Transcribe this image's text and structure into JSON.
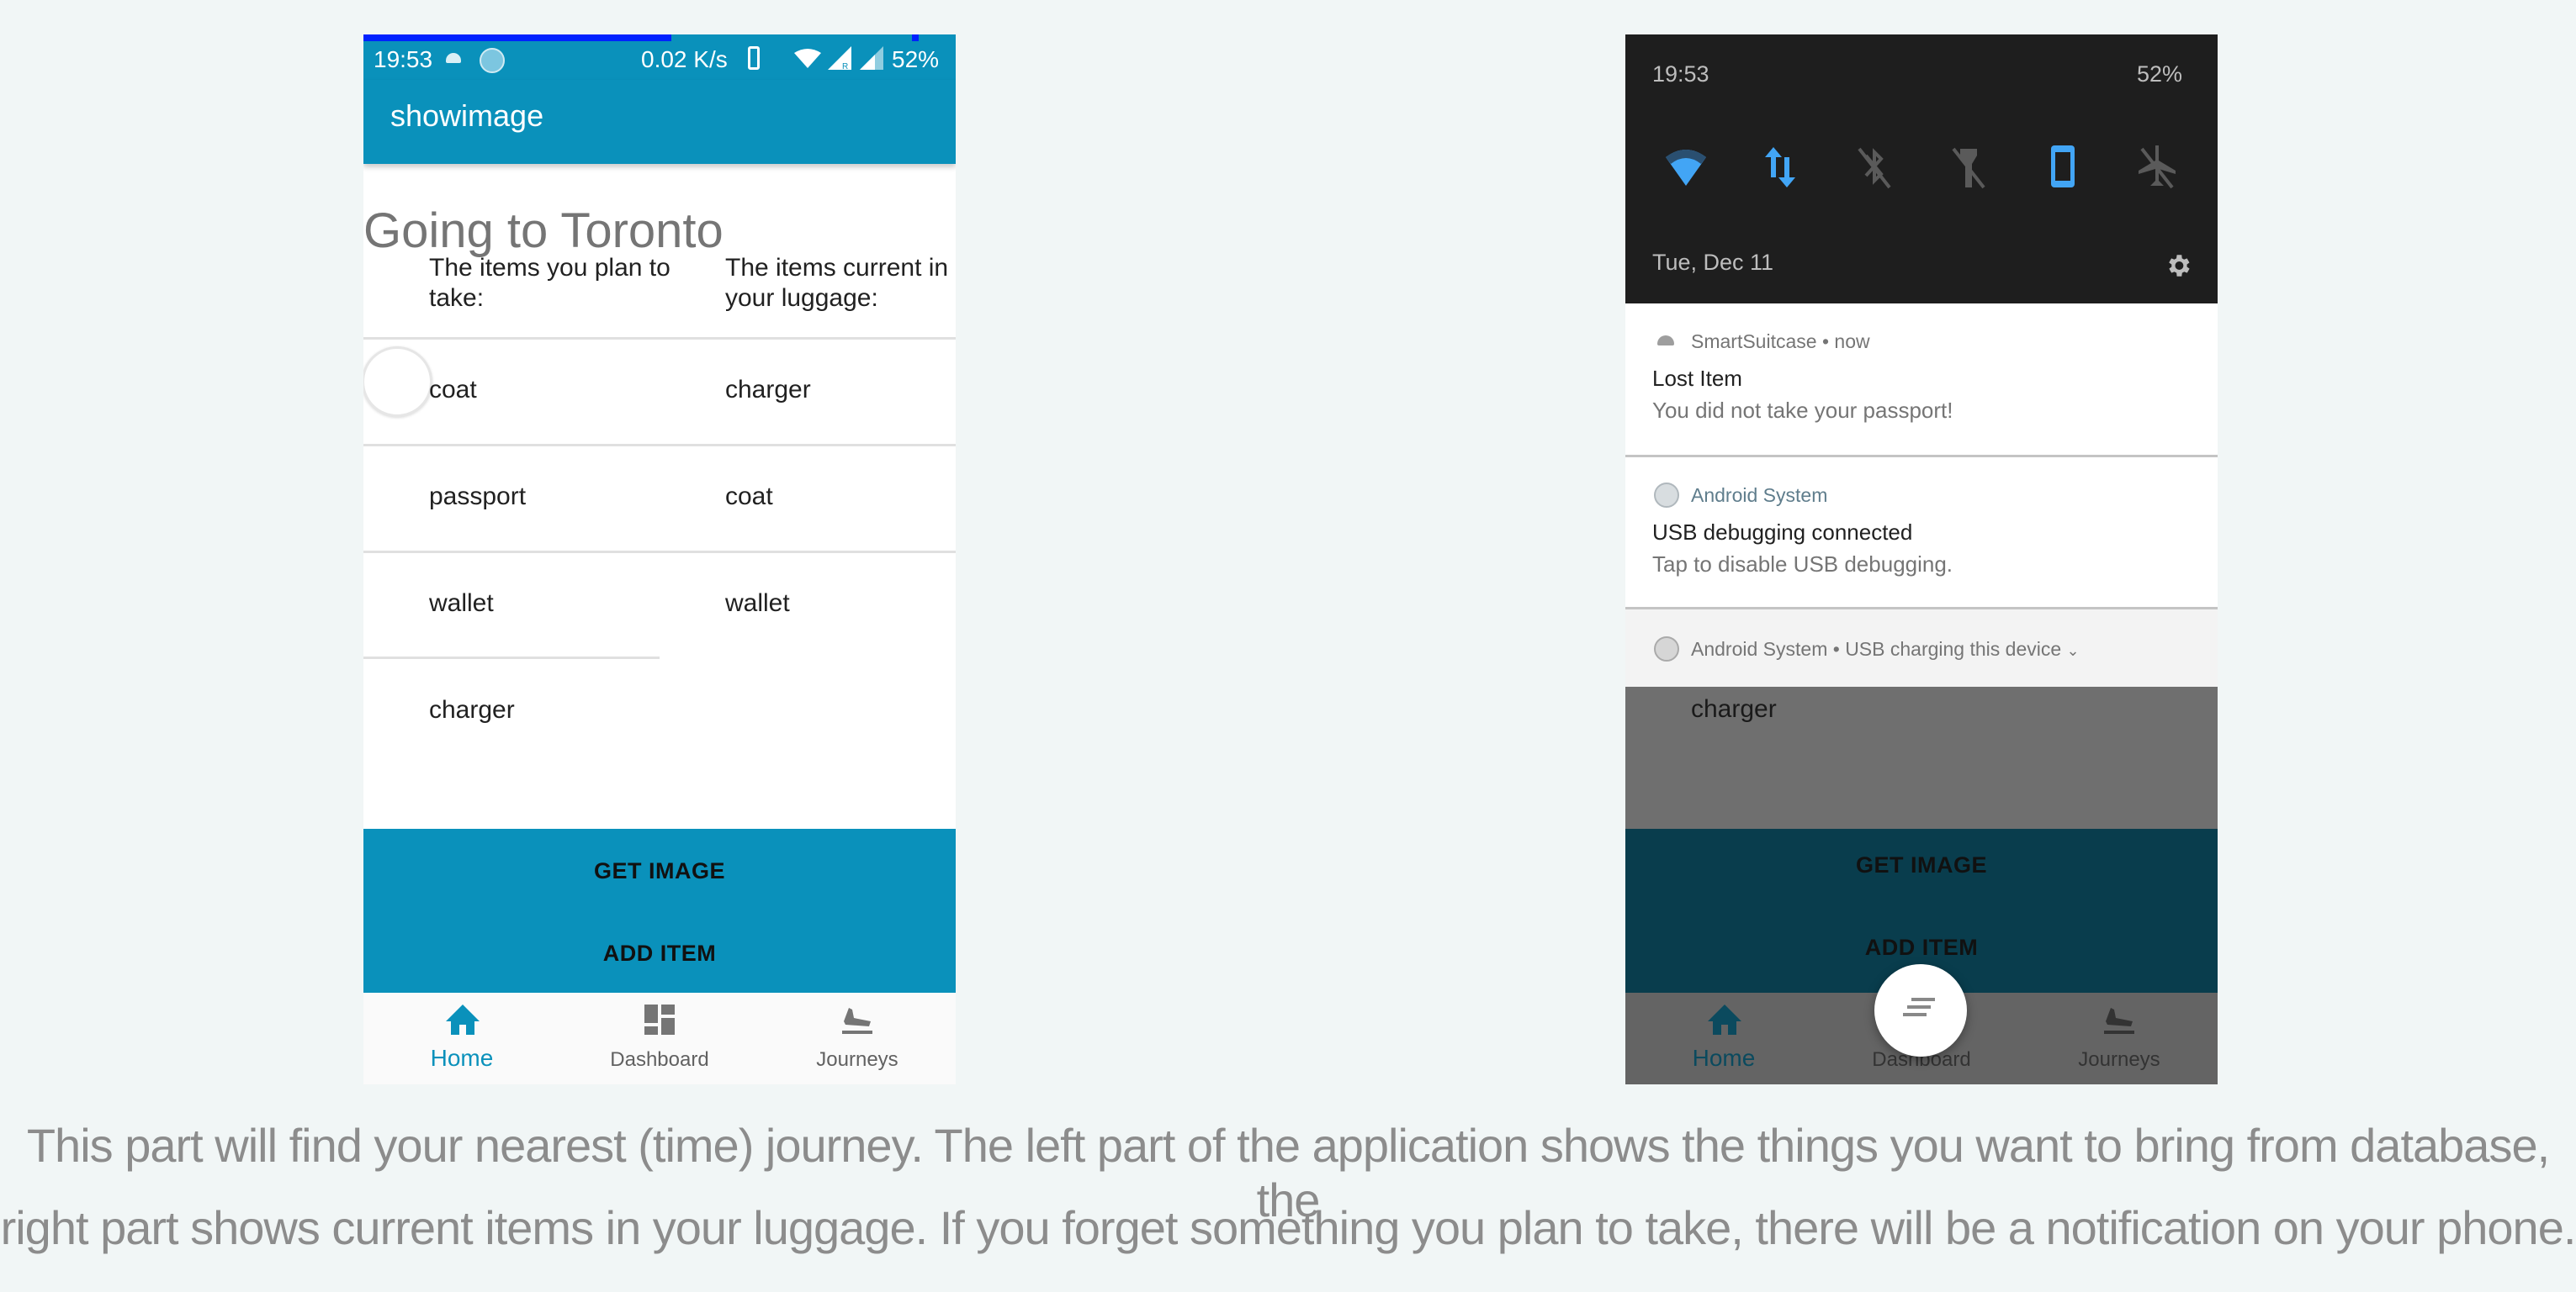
{
  "left_phone": {
    "status_bar": {
      "time": "19:53",
      "net_speed": "0.02 K/s",
      "battery": "52%",
      "download_progress_percent": 52,
      "icons": [
        "android-icon",
        "sync-icon",
        "vibrate-icon",
        "wifi-icon",
        "signal-roaming-icon",
        "signal-icon"
      ]
    },
    "app_bar": {
      "title": "showimage"
    },
    "page_title": "Going to Toronto",
    "columns": {
      "planned_header": "The items you plan to take:",
      "current_header": "The items current in your luggage:"
    },
    "planned_items": [
      "coat",
      "passport",
      "wallet",
      "charger"
    ],
    "current_items": [
      "charger",
      "coat",
      "wallet"
    ],
    "buttons": {
      "get_image": "GET IMAGE",
      "add_item": "ADD ITEM"
    },
    "nav": [
      {
        "label": "Home",
        "icon": "home-icon",
        "active": true
      },
      {
        "label": "Dashboard",
        "icon": "dashboard-icon",
        "active": false
      },
      {
        "label": "Journeys",
        "icon": "flight-land-icon",
        "active": false
      }
    ]
  },
  "right_phone": {
    "shade": {
      "time": "19:53",
      "battery": "52%",
      "date": "Tue, Dec 11",
      "quick_settings": [
        {
          "name": "wifi",
          "state": "on"
        },
        {
          "name": "mobile-data",
          "state": "on"
        },
        {
          "name": "bluetooth",
          "state": "off"
        },
        {
          "name": "flashlight",
          "state": "off"
        },
        {
          "name": "auto-rotate",
          "state": "on"
        },
        {
          "name": "airplane-mode",
          "state": "off"
        }
      ]
    },
    "notifications": [
      {
        "app": "SmartSuitcase",
        "sep": " • ",
        "when": "now",
        "title": "Lost Item",
        "body": "You did not take your passport!"
      },
      {
        "app": "Android System",
        "title": "USB debugging connected",
        "body": "Tap to disable USB debugging."
      },
      {
        "app": "Android System",
        "summary": " • USB charging this device"
      }
    ],
    "behind": {
      "visible_item": "charger",
      "buttons": {
        "get_image": "GET IMAGE",
        "add_item": "ADD ITEM"
      },
      "nav": [
        "Home",
        "Dashboard",
        "Journeys"
      ]
    }
  },
  "caption": {
    "line1": "This part will find your nearest (time) journey. The left part of the application shows the things you want to bring from database, the",
    "line2": "right part shows current items in your luggage. If you forget something you plan to take, there will be a notification on your phone."
  },
  "colors": {
    "accent": "#0a91bb",
    "accent_dim": "#093d4d",
    "shade": "#1e1e1e",
    "qs_on": "#42a5f5",
    "qs_off": "#5a5a5a"
  }
}
